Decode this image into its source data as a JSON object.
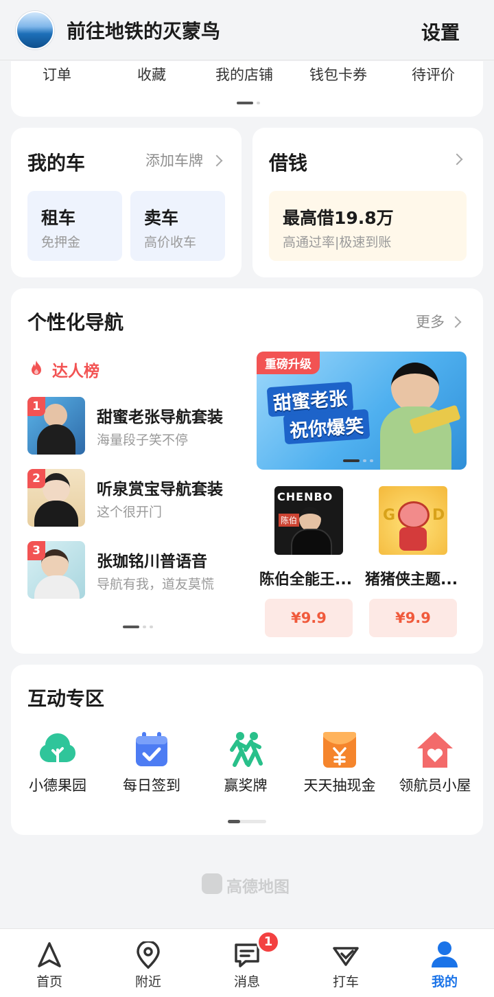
{
  "header": {
    "username": "前往地铁的灭蒙鸟",
    "settings_label": "设置"
  },
  "quick_menu": {
    "items": [
      "订单",
      "收藏",
      "我的店铺",
      "钱包卡券",
      "待评价"
    ]
  },
  "car": {
    "title": "我的车",
    "add_plate_label": "添加车牌",
    "rent": {
      "label": "租车",
      "sub": "免押金"
    },
    "sell": {
      "label": "卖车",
      "sub": "高价收车"
    }
  },
  "loan": {
    "title": "借钱",
    "offer": "最高借19.8万",
    "sub": "高通过率|极速到账"
  },
  "nav": {
    "title": "个性化导航",
    "more_label": "更多",
    "ranking_label": "达人榜",
    "ranking": [
      {
        "rank": "1",
        "name": "甜蜜老张导航套装",
        "desc": "海量段子笑不停"
      },
      {
        "rank": "2",
        "name": "听泉赏宝导航套装",
        "desc": "这个很开门"
      },
      {
        "rank": "3",
        "name": "张珈铭川普语音",
        "desc": "导航有我，道友莫慌"
      }
    ],
    "banner": {
      "tag": "重磅升级",
      "line1": "甜蜜老张",
      "line2": "祝你爆笑"
    },
    "products": [
      {
        "name": "陈伯全能王...",
        "price": "¥9.9",
        "thumb_text": "CHENBO",
        "thumb_sub": "陈伯"
      },
      {
        "name": "猪猪侠主题...",
        "price": "¥9.9"
      }
    ]
  },
  "interact": {
    "title": "互动专区",
    "items": [
      {
        "label": "小德果园",
        "icon": "tree-icon",
        "color": "#2fc59a"
      },
      {
        "label": "每日签到",
        "icon": "calendar-check-icon",
        "color": "#4d7cf3"
      },
      {
        "label": "赢奖牌",
        "icon": "running-people-icon",
        "color": "#29c08a"
      },
      {
        "label": "天天抽现金",
        "icon": "red-envelope-icon",
        "color": "#f5852c"
      },
      {
        "label": "领航员小屋",
        "icon": "house-icon",
        "color": "#f36a6a"
      }
    ]
  },
  "footer": {
    "brand": "高德地图"
  },
  "tabbar": {
    "items": [
      {
        "label": "首页",
        "icon": "navigation-arrow-icon"
      },
      {
        "label": "附近",
        "icon": "location-pin-icon"
      },
      {
        "label": "消息",
        "icon": "message-icon",
        "badge": "1"
      },
      {
        "label": "打车",
        "icon": "taxi-icon"
      },
      {
        "label": "我的",
        "icon": "person-icon",
        "active": true
      }
    ]
  },
  "colors": {
    "accent": "#1a73e8",
    "badge": "#f34141",
    "price": "#f05a3c",
    "ranking": "#f25353"
  }
}
